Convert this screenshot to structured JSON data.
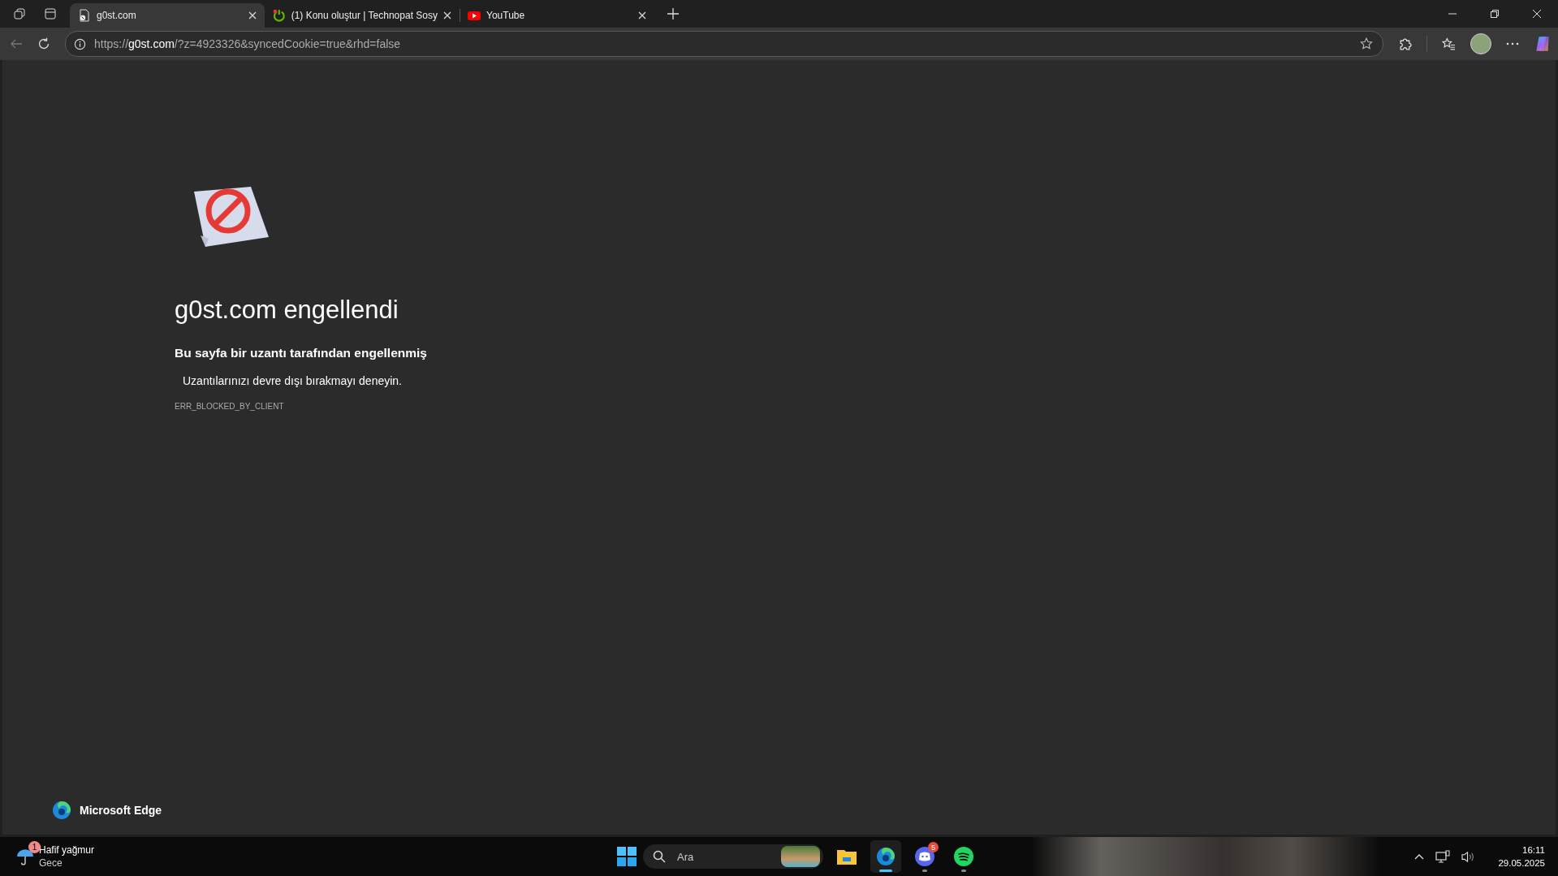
{
  "tabs": [
    {
      "title": "g0st.com",
      "kind": "blocked",
      "selected": true
    },
    {
      "title": "(1) Konu oluştur | Technopat Sosy",
      "kind": "technopat",
      "selected": false
    },
    {
      "title": "YouTube",
      "kind": "youtube",
      "selected": false
    }
  ],
  "address_bar": {
    "scheme": "https://",
    "host": "g0st.com",
    "path": "/?z=4923326&syncedCookie=true&rhd=false"
  },
  "page": {
    "heading": "g0st.com engellendi",
    "subheading": "Bu sayfa bir uzantı tarafından engellenmiş",
    "suggestion": "Uzantılarınızı devre dışı bırakmayı deneyin.",
    "error_code": "ERR_BLOCKED_BY_CLIENT",
    "brand": "Microsoft Edge"
  },
  "taskbar": {
    "weather": {
      "badge": "1",
      "condition": "Hafif yağmur",
      "period": "Gece"
    },
    "search": {
      "placeholder": "Ara"
    },
    "apps": [
      {
        "kind": "explorer",
        "active": false,
        "running": false
      },
      {
        "kind": "edge",
        "active": true,
        "running": true
      },
      {
        "kind": "discord",
        "active": false,
        "running": true,
        "badge": "5"
      },
      {
        "kind": "spotify",
        "active": false,
        "running": true
      }
    ],
    "time": "16:11",
    "date": "29.05.2025"
  }
}
